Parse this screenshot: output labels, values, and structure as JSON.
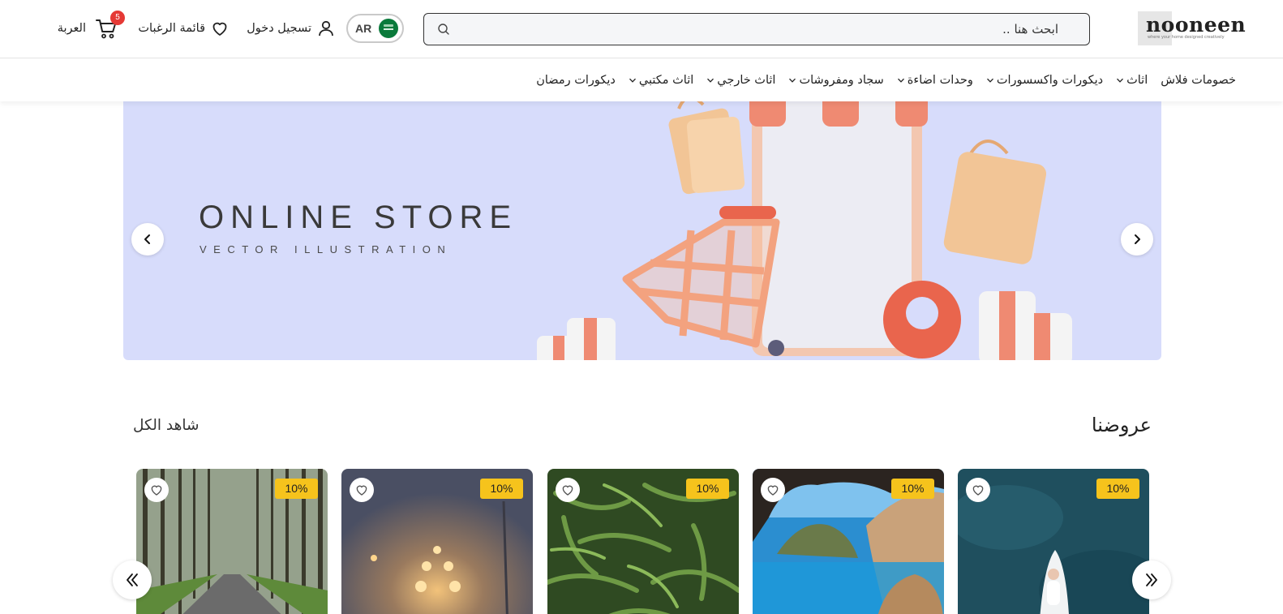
{
  "header": {
    "logo": {
      "text": "nooneen",
      "tagline": "where your home designed creatively"
    },
    "search": {
      "placeholder": "ابحث هنا ..",
      "icon": "search-icon"
    },
    "language": {
      "code": "AR",
      "flag_icon": "saudi-flag-icon"
    },
    "login_label": "تسجيل دخول",
    "wishlist_label": "قائمة الرغبات",
    "cart": {
      "label": "العربة",
      "count": "5"
    }
  },
  "nav": {
    "items": [
      {
        "label": "خصومات فلاش",
        "has_dropdown": false
      },
      {
        "label": "اثاث",
        "has_dropdown": true
      },
      {
        "label": "ديكورات واكسسورات",
        "has_dropdown": true
      },
      {
        "label": "وحدات اضاءة",
        "has_dropdown": true
      },
      {
        "label": "سجاد ومفروشات",
        "has_dropdown": true
      },
      {
        "label": "اثاث خارجي",
        "has_dropdown": true
      },
      {
        "label": "اثاث مكتبي",
        "has_dropdown": true
      },
      {
        "label": "ديكورات رمضان",
        "has_dropdown": false
      }
    ]
  },
  "hero": {
    "title": "ONLINE STORE",
    "subtitle": "VECTOR ILLUSTRATION",
    "background": "#d7dcfb"
  },
  "offers": {
    "title": "عروضنا",
    "see_all": "شاهد الكل",
    "products": [
      {
        "discount": "10%",
        "image": "woman-on-paddleboard-photo"
      },
      {
        "discount": "10%",
        "image": "sea-cliff-cove-photo"
      },
      {
        "discount": "10%",
        "image": "green-beans-photo"
      },
      {
        "discount": "10%",
        "image": "foggy-street-lights-photo"
      },
      {
        "discount": "10%",
        "image": "forest-road-photo"
      }
    ]
  },
  "colors": {
    "badge": "#f6c31c",
    "cart_badge": "#e53935",
    "hero_bg": "#d7dcfb"
  }
}
